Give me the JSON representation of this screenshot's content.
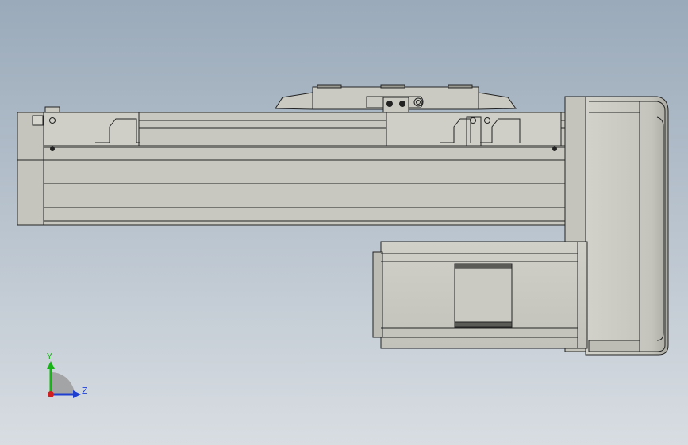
{
  "viewport": {
    "background_top": "#9aaaba",
    "background_bottom": "#d8dde2",
    "part_fill": "#c9c9c0",
    "part_fill_dark": "#aeaea6",
    "edge_color": "#222222"
  },
  "triad": {
    "y_label": "Y",
    "z_label": "Z",
    "y_color": "#19b219",
    "z_color": "#1f3fd1",
    "x_color": "#d11f1f"
  }
}
